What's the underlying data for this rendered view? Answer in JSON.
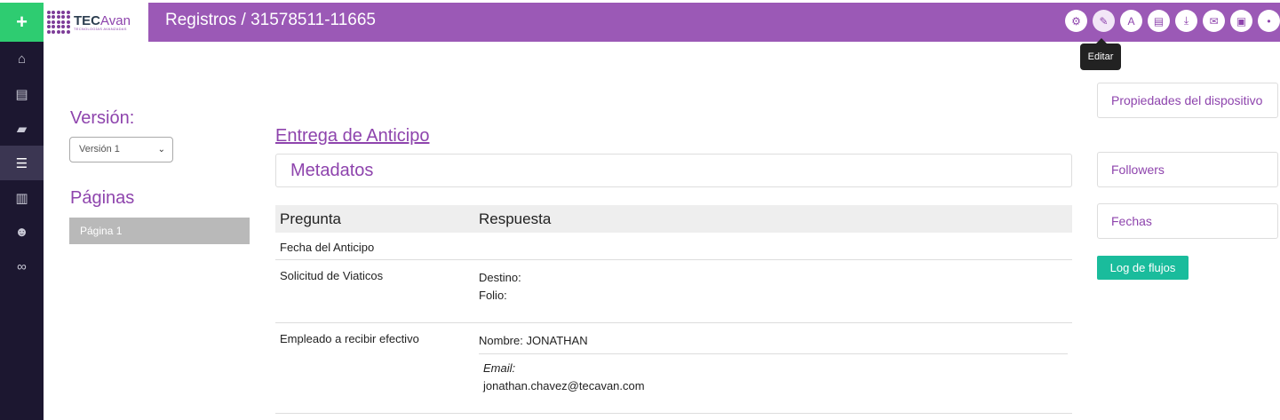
{
  "header": {
    "plus_label": "+",
    "logo_main": "TEC",
    "logo_accent": "Avan",
    "logo_sub": "TECNOLOGÍAS AVANZADAS",
    "title": "Registros / 31578511-11665",
    "toolbar": [
      {
        "icon": "gear-icon",
        "glyph": "⚙"
      },
      {
        "icon": "pencil-icon",
        "glyph": "✎"
      },
      {
        "icon": "font-icon",
        "glyph": "A"
      },
      {
        "icon": "file-icon",
        "glyph": "▤"
      },
      {
        "icon": "download-icon",
        "glyph": "⤓"
      },
      {
        "icon": "envelope-icon",
        "glyph": "✉"
      },
      {
        "icon": "archive-icon",
        "glyph": "▣"
      },
      {
        "icon": "more-icon",
        "glyph": "•"
      }
    ],
    "tooltip": "Editar"
  },
  "sidebar": [
    {
      "icon": "home-icon",
      "glyph": "⌂"
    },
    {
      "icon": "document-icon",
      "glyph": "▤"
    },
    {
      "icon": "book-icon",
      "glyph": "▰"
    },
    {
      "icon": "list-icon",
      "glyph": "☰"
    },
    {
      "icon": "bar-chart-icon",
      "glyph": "▥"
    },
    {
      "icon": "users-icon",
      "glyph": "☻"
    },
    {
      "icon": "link-icon",
      "glyph": "∞"
    }
  ],
  "left": {
    "version_label": "Versión:",
    "version_selected": "Versión 1",
    "pages_label": "Páginas",
    "page_item": "Página 1"
  },
  "main": {
    "form_title": "Entrega de Anticipo",
    "metadata": "Metadatos",
    "col_question": "Pregunta",
    "col_answer": "Respuesta",
    "rows": [
      {
        "question": "Fecha del Anticipo"
      },
      {
        "question": "Solicitud de Viaticos",
        "destino": "Destino:",
        "folio": "Folio:"
      },
      {
        "question": "Empleado a recibir efectivo",
        "nombre_label": "Nombre:",
        "nombre": "JONATHAN",
        "email_label": "Email:",
        "email": "jonathan.chavez@tecavan.com"
      }
    ]
  },
  "right": {
    "props": "Propiedades del dispositivo",
    "followers": "Followers",
    "fechas": "Fechas",
    "log": "Log de flujos"
  }
}
